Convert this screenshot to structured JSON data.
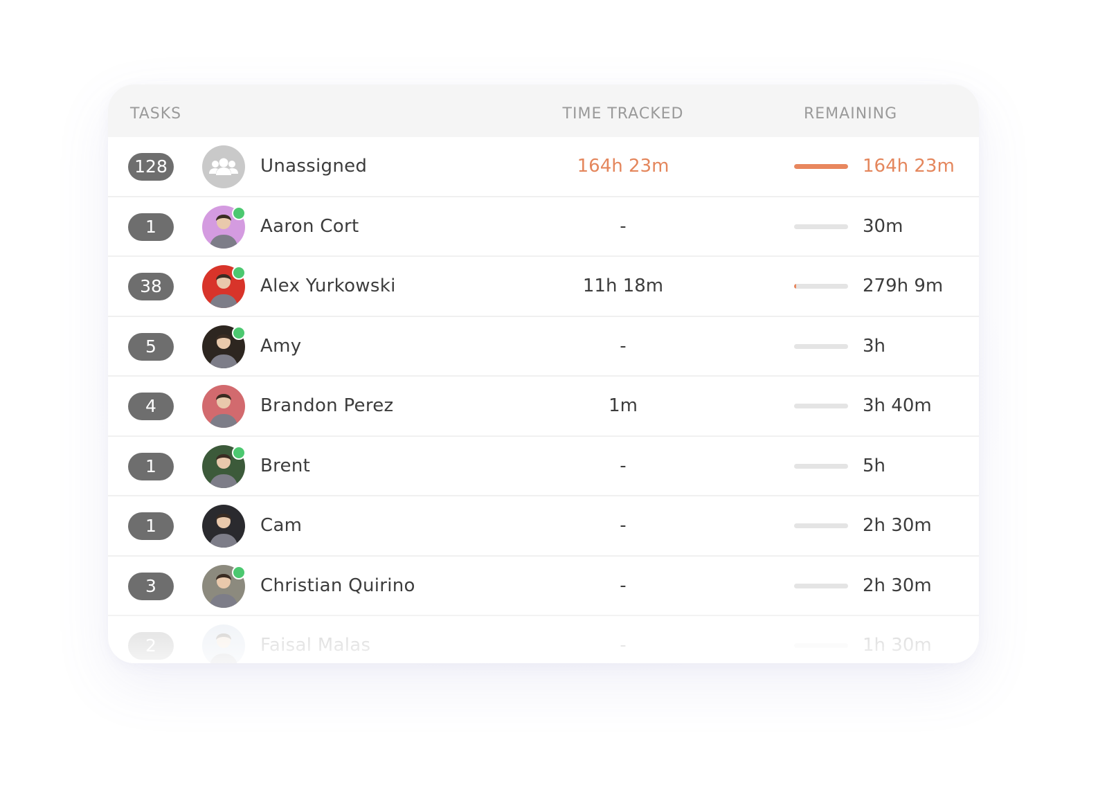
{
  "columns": {
    "tasks": "TASKS",
    "time_tracked": "TIME TRACKED",
    "remaining": "REMAINING"
  },
  "colors": {
    "accent": "#e4865c",
    "badge": "#6e6e6e",
    "online": "#4cc870",
    "header_bg": "#f5f5f5"
  },
  "rows": [
    {
      "tasks": "128",
      "name": "Unassigned",
      "tracked": "164h 23m",
      "remaining": "164h 23m",
      "remaining_fraction": 1.0,
      "online": false,
      "avatar": "group-icon",
      "avatar_bg": "#c9c9c9"
    },
    {
      "tasks": "1",
      "name": "Aaron Cort",
      "tracked": "-",
      "remaining": "30m",
      "remaining_fraction": 0,
      "online": true,
      "avatar": "person",
      "avatar_bg": "#d49be0"
    },
    {
      "tasks": "38",
      "name": "Alex Yurkowski",
      "tracked": "11h 18m",
      "remaining": "279h 9m",
      "remaining_fraction": 0.04,
      "online": true,
      "avatar": "person",
      "avatar_bg": "#d8342a"
    },
    {
      "tasks": "5",
      "name": "Amy",
      "tracked": "-",
      "remaining": "3h",
      "remaining_fraction": 0,
      "online": true,
      "avatar": "person",
      "avatar_bg": "#2d2620"
    },
    {
      "tasks": "4",
      "name": "Brandon Perez",
      "tracked": "1m",
      "remaining": "3h 40m",
      "remaining_fraction": 0,
      "online": false,
      "avatar": "person",
      "avatar_bg": "#d26a6e"
    },
    {
      "tasks": "1",
      "name": "Brent",
      "tracked": "-",
      "remaining": "5h",
      "remaining_fraction": 0,
      "online": true,
      "avatar": "person",
      "avatar_bg": "#3c5a3a"
    },
    {
      "tasks": "1",
      "name": "Cam",
      "tracked": "-",
      "remaining": "2h 30m",
      "remaining_fraction": 0,
      "online": false,
      "avatar": "person",
      "avatar_bg": "#2a2a2e"
    },
    {
      "tasks": "3",
      "name": "Christian Quirino",
      "tracked": "-",
      "remaining": "2h 30m",
      "remaining_fraction": 0,
      "online": true,
      "avatar": "person",
      "avatar_bg": "#8c8a7e"
    },
    {
      "tasks": "2",
      "name": "Faisal Malas",
      "tracked": "-",
      "remaining": "1h 30m",
      "remaining_fraction": 0,
      "online": false,
      "avatar": "person",
      "avatar_bg": "#b8c8dc"
    }
  ]
}
